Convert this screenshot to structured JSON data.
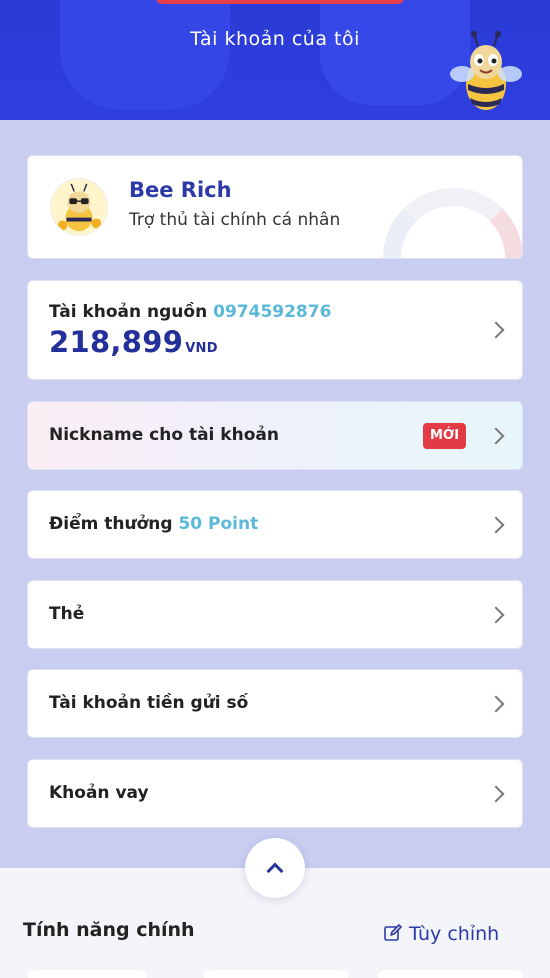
{
  "header": {
    "title": "Tài khoản của tôi"
  },
  "bee": {
    "name": "Bee Rich",
    "subtitle": "Trợ thủ tài chính cá nhân"
  },
  "source_account": {
    "label": "Tài khoản nguồn",
    "phone": "0974592876",
    "amount": "218,899",
    "currency": "VND"
  },
  "menu": {
    "nickname": {
      "label": "Nickname cho tài khoản",
      "badge": "MỚI"
    },
    "points": {
      "label": "Điểm thưởng",
      "value": "50 Point"
    },
    "cards": {
      "label": "Thẻ"
    },
    "savings": {
      "label": "Tài khoản tiền gửi số"
    },
    "loan": {
      "label": "Khoản vay"
    }
  },
  "features": {
    "title": "Tính năng chính",
    "customize": "Tùy chỉnh"
  },
  "colors": {
    "primary": "#2f3fe0",
    "accent_text": "#5bb8d8",
    "badge": "#e23b46",
    "navy": "#23309a"
  },
  "icons": {
    "chevron": "chevron-right-icon",
    "collapse": "chevron-up-icon",
    "edit": "edit-icon"
  }
}
